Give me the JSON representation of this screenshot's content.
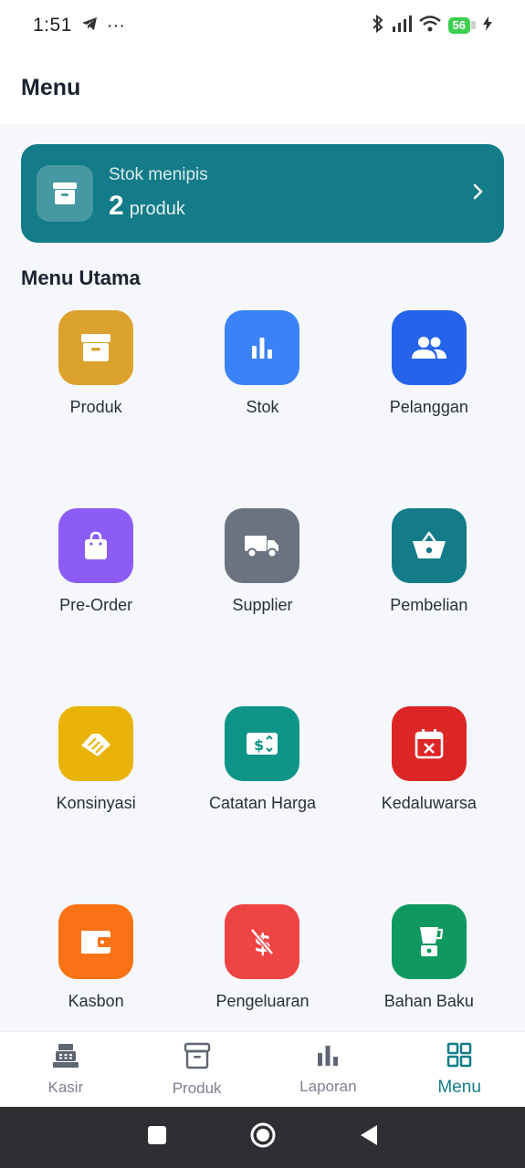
{
  "status_bar": {
    "time": "1:51",
    "dots": "···",
    "battery": "56"
  },
  "header": {
    "title": "Menu"
  },
  "stock_card": {
    "label": "Stok menipis",
    "count": "2",
    "unit": "produk"
  },
  "section_title": "Menu Utama",
  "menu": [
    {
      "label": "Produk",
      "icon": "archive-icon",
      "color": "#dca22e"
    },
    {
      "label": "Stok",
      "icon": "bar-chart-icon",
      "color": "#3b82f6"
    },
    {
      "label": "Pelanggan",
      "icon": "users-icon",
      "color": "#2563eb"
    },
    {
      "label": "Pre-Order",
      "icon": "shopping-bag-icon",
      "color": "#8b5cf6"
    },
    {
      "label": "Supplier",
      "icon": "truck-icon",
      "color": "#6b7280"
    },
    {
      "label": "Pembelian",
      "icon": "basket-icon",
      "color": "#137c88"
    },
    {
      "label": "Konsinyasi",
      "icon": "handshake-icon",
      "color": "#eab308"
    },
    {
      "label": "Catatan Harga",
      "icon": "price-tag-icon",
      "color": "#0f9488"
    },
    {
      "label": "Kedaluwarsa",
      "icon": "calendar-x-icon",
      "color": "#dc2626"
    },
    {
      "label": "Kasbon",
      "icon": "wallet-icon",
      "color": "#f97316"
    },
    {
      "label": "Pengeluaran",
      "icon": "money-off-icon",
      "color": "#ef4444"
    },
    {
      "label": "Bahan Baku",
      "icon": "blender-icon",
      "color": "#0f9960"
    }
  ],
  "bottom_nav": [
    {
      "label": "Kasir",
      "icon": "cash-register-icon",
      "active": false
    },
    {
      "label": "Produk",
      "icon": "archive-icon",
      "active": false
    },
    {
      "label": "Laporan",
      "icon": "bar-chart-icon",
      "active": false
    },
    {
      "label": "Menu",
      "icon": "grid-icon",
      "active": true
    }
  ],
  "colors": {
    "accent": "#137c88",
    "inactive_nav": "#7b8190"
  }
}
